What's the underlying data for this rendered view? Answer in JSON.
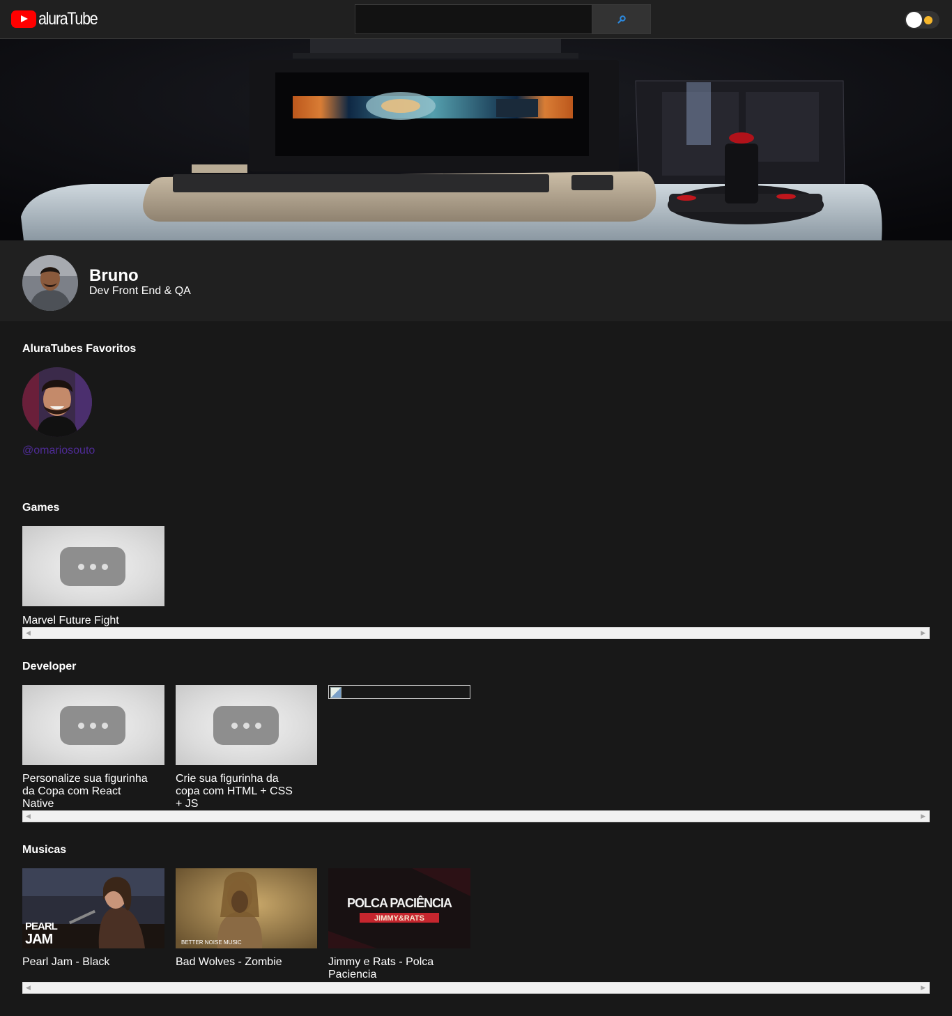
{
  "header": {
    "logo_text": "aluraTube",
    "search": {
      "value": "",
      "placeholder": ""
    },
    "search_icon": "search-icon",
    "theme_toggle": {
      "state": "dark",
      "icon": "sun-icon"
    }
  },
  "banner": {
    "description": "retro computer banner image"
  },
  "profile": {
    "name": "Bruno",
    "job": "Dev Front End & QA"
  },
  "favorites": {
    "title": "AluraTubes Favoritos",
    "items": [
      {
        "handle": "@omariosouto"
      }
    ]
  },
  "playlists": [
    {
      "title": "Games",
      "videos": [
        {
          "title": "Marvel Future Fight",
          "thumb": "placeholder"
        }
      ]
    },
    {
      "title": "Developer",
      "videos": [
        {
          "title": "Personalize sua figurinha da Copa com React Native",
          "thumb": "placeholder"
        },
        {
          "title": "Crie sua figurinha da copa com HTML + CSS + JS",
          "thumb": "placeholder"
        },
        {
          "title": "",
          "thumb": "broken"
        }
      ]
    },
    {
      "title": "Musicas",
      "videos": [
        {
          "title": "Pearl Jam - Black",
          "thumb": "pearl-jam",
          "thumb_text": "PEARL JAM"
        },
        {
          "title": "Bad Wolves - Zombie",
          "thumb": "bad-wolves",
          "thumb_text": "BETTER NOISE MUSIC"
        },
        {
          "title": "Jimmy e Rats - Polca Paciencia",
          "thumb": "polca",
          "thumb_text": "POLCA PACIÊNCIA",
          "thumb_subtext": "JIMMY&RATS"
        }
      ]
    }
  ],
  "colors": {
    "background": "#181818",
    "surface": "#202020",
    "brand_red": "#ff0000",
    "link_purple": "#4e2b96",
    "toggle_sun": "#f6b62a"
  }
}
